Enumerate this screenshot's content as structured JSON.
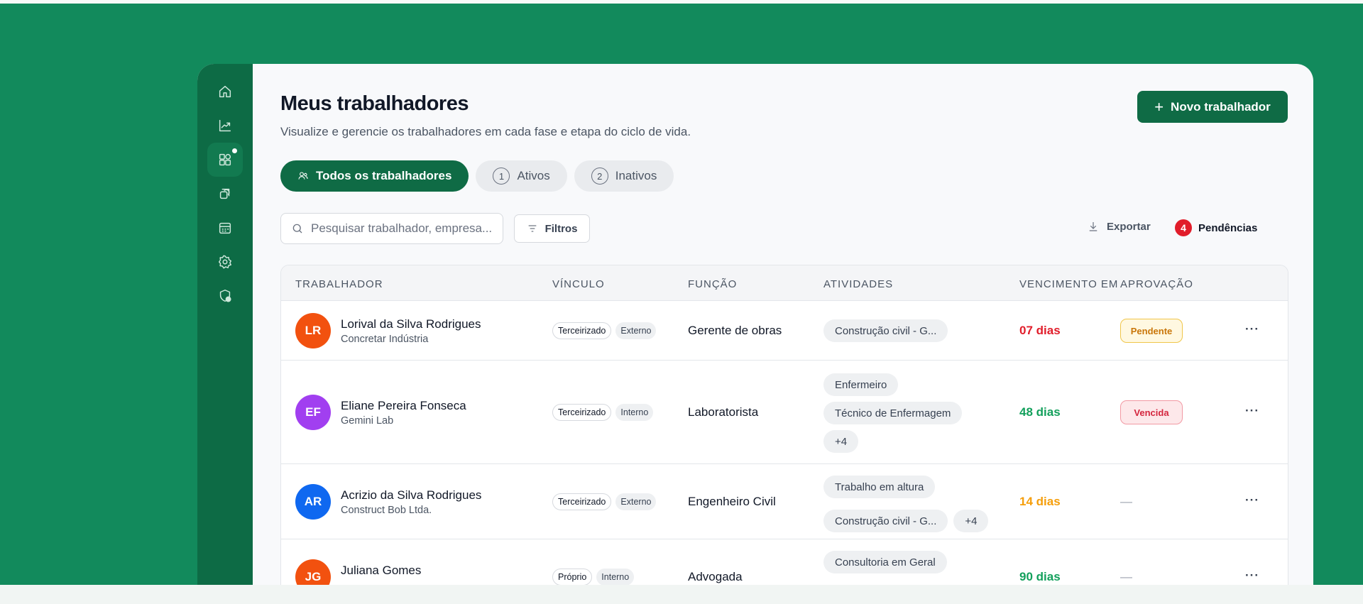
{
  "header": {
    "title": "Meus trabalhadores",
    "subtitle": "Visualize e gerencie os trabalhadores em cada fase e etapa do ciclo de vida.",
    "new_button": "Novo trabalhador"
  },
  "tabs": [
    {
      "label": "Todos os trabalhadores",
      "num": ""
    },
    {
      "label": "Ativos",
      "num": "1"
    },
    {
      "label": "Inativos",
      "num": "2"
    }
  ],
  "toolbar": {
    "search_placeholder": "Pesquisar trabalhador, empresa...",
    "filters": "Filtros",
    "export": "Exportar",
    "pending_count": "4",
    "pending_label": "Pendências"
  },
  "table": {
    "headers": {
      "worker": "TRABALHADOR",
      "link": "VÍNCULO",
      "role": "FUNÇÃO",
      "activities": "ATIVIDADES",
      "due": "VENCIMENTO EM",
      "approval": "APROVAÇÃO"
    },
    "rows": [
      {
        "initials": "LR",
        "name": "Lorival da Silva Rodrigues",
        "company": "Concretar Indústria",
        "link1": "Terceirizado",
        "link2": "Externo",
        "role": "Gerente de obras",
        "activities": [
          "Construção civil - G..."
        ],
        "due": "07 dias",
        "approval": "Pendente",
        "more": "···"
      },
      {
        "initials": "EF",
        "name": "Eliane Pereira Fonseca",
        "company": "Gemini Lab",
        "link1": "Terceirizado",
        "link2": "Interno",
        "role": "Laboratorista",
        "activities": [
          "Enfermeiro",
          "Técnico de Enfermagem",
          "+4"
        ],
        "due": "48 dias",
        "approval": "Vencida",
        "more": "···"
      },
      {
        "initials": "AR",
        "name": "Acrizio da Silva Rodrigues",
        "company": "Construct Bob Ltda.",
        "link1": "Terceirizado",
        "link2": "Externo",
        "role": "Engenheiro Civil",
        "activities": [
          "Trabalho em altura",
          "Construção civil - G...",
          "+4"
        ],
        "due": "14 dias",
        "approval": "—",
        "more": "···"
      },
      {
        "initials": "JG",
        "name": "Juliana Gomes",
        "company": "",
        "link1": "Próprio",
        "link2": "Interno",
        "role": "Advogada",
        "activities": [
          "Consultoria em Geral"
        ],
        "due": "90 dias",
        "approval": "—",
        "more": "···"
      }
    ]
  },
  "colors": {
    "brand": "#0f6b45",
    "background": "#128a5c",
    "avatar_lr": "#f2510f",
    "avatar_ef": "#a13ff0",
    "avatar_ar": "#0f68f0",
    "avatar_jg": "#f2510f",
    "due_red": "#e11d2a",
    "due_green": "#13a05c",
    "due_orange": "#f59e0b"
  },
  "sidebar_icons": [
    "home-icon",
    "chart-icon",
    "dashboard-icon",
    "layers-icon",
    "calendar-icon",
    "settings-icon",
    "shield-check-icon"
  ]
}
